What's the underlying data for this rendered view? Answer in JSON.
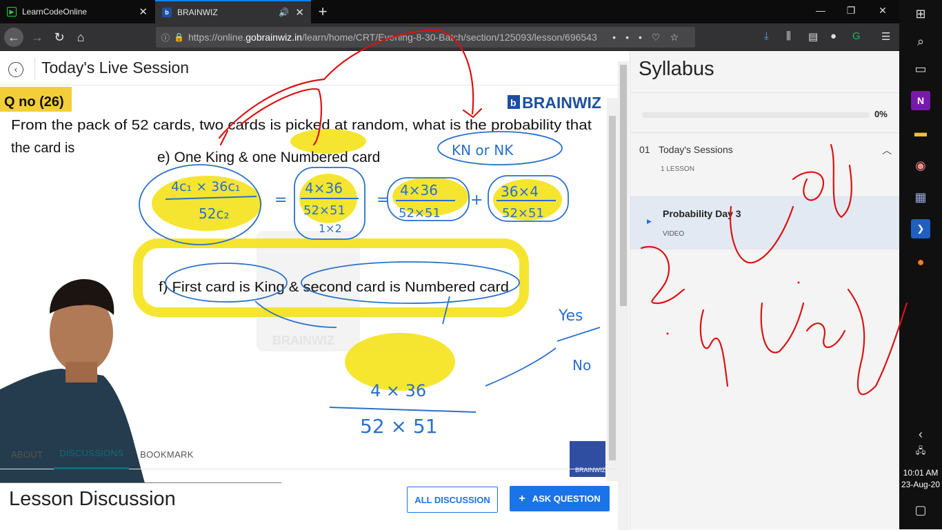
{
  "browser": {
    "tabs": [
      {
        "title": "LearnCodeOnline"
      },
      {
        "title": "BRAINWIZ"
      }
    ],
    "url_prefix": "https://online.",
    "url_domain": "gobrainwiz.in",
    "url_path": "/learn/home/CRT/Evening-8-30-Batch/section/125093/lesson/696543",
    "url_overflow": "•••"
  },
  "lesson": {
    "header_title": "Today's Live Session",
    "tabs": [
      "ABOUT",
      "DISCUSSIONS",
      "BOOKMARK"
    ],
    "active_tab": "DISCUSSIONS",
    "discussion_title": "Lesson Discussion",
    "all_discussion_label": "ALL DISCUSSION",
    "ask_question_label": "ASK QUESTION"
  },
  "video": {
    "question_label": "Q no (26)",
    "logo_text": "BRAINWIZ",
    "question_line1": "From the pack of 52 cards, two cards is picked at random, what is the probability that",
    "question_line2": "the card is",
    "part_e": "e) One King & one Numbered card",
    "part_f": "f) First card is King & second card is Numbered card",
    "watermark": "BRAINWIZ",
    "corner_logo": "BRAINWIZ",
    "ink": {
      "kn_nk": "KN or NK",
      "comb_top": "4c₁ × 36c₁",
      "comb_bottom": "52c₂",
      "frac1_top": "4×36",
      "frac1_bottom": "52×51",
      "frac1_extra": "1×2",
      "frac2_top": "4×36",
      "frac2_bottom": "52×51",
      "frac3_top": "36×4",
      "frac3_bottom": "52×51",
      "f_top": "4 × 36",
      "f_bottom": "52 × 51",
      "yes": "Yes",
      "no": "No"
    }
  },
  "syllabus": {
    "title": "Syllabus",
    "progress_value": 0,
    "progress_label": "0%",
    "sections": [
      {
        "number": "01",
        "name": "Today's Sessions",
        "count": "1 LESSON",
        "items": [
          {
            "name": "Probability Day 3",
            "type": "VIDEO"
          }
        ]
      }
    ]
  },
  "taskbar": {
    "time": "10:01 AM",
    "date": "23-Aug-20"
  },
  "colors": {
    "accent": "#1a73e8",
    "active_tab": "#0b6e79",
    "highlight": "#f5e31a",
    "ink_red": "#d11",
    "ink_blue": "#2a6fc9"
  }
}
